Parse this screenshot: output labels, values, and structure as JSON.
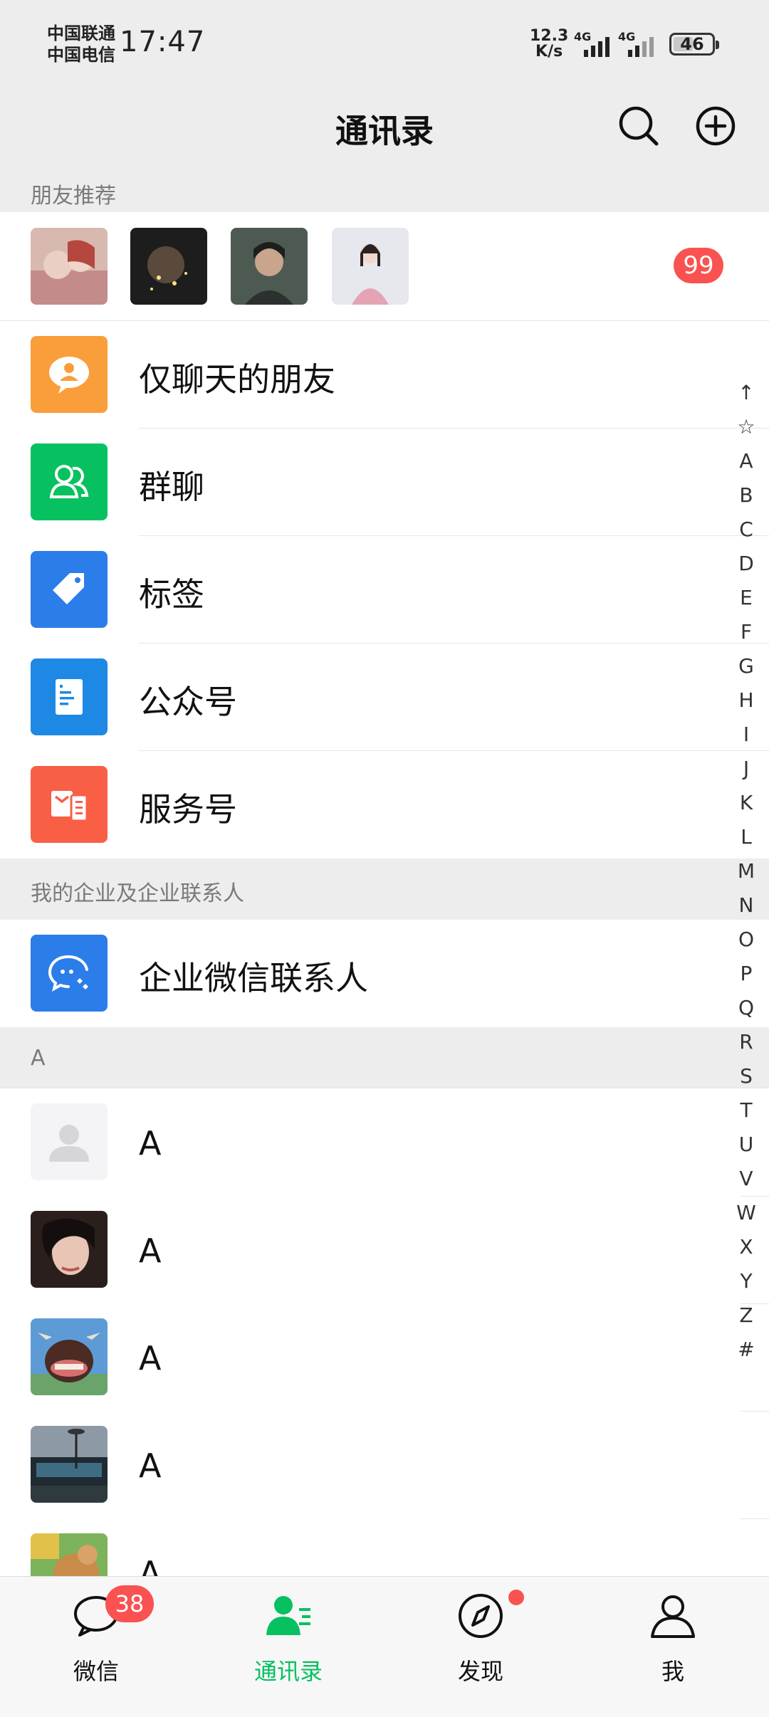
{
  "status_bar": {
    "carrier_1": "中国联通",
    "carrier_2": "中国电信",
    "time": "17:47",
    "net_speed_value": "12.3",
    "net_speed_unit": "K/s",
    "signal_1_label": "4G",
    "signal_2_label": "4G",
    "battery": "46"
  },
  "header": {
    "title": "通讯录",
    "search_icon": "search-icon",
    "add_icon": "add-circle-icon"
  },
  "recommend": {
    "section_label": "朋友推荐",
    "badge": "99"
  },
  "features": [
    {
      "label": "仅聊天的朋友",
      "icon": "chat-only-friends-icon",
      "color": "#fa9d3b"
    },
    {
      "label": "群聊",
      "icon": "group-chat-icon",
      "color": "#07c160"
    },
    {
      "label": "标签",
      "icon": "tag-icon",
      "color": "#2b7de9"
    },
    {
      "label": "公众号",
      "icon": "official-account-icon",
      "color": "#1e88e5"
    },
    {
      "label": "服务号",
      "icon": "service-account-icon",
      "color": "#f95f45"
    }
  ],
  "enterprise": {
    "section_label": "我的企业及企业联系人",
    "item_label": "企业微信联系人",
    "color": "#2b7de9"
  },
  "contacts": {
    "section_label": "A",
    "items": [
      {
        "name": "A"
      },
      {
        "name": "A"
      },
      {
        "name": "A"
      },
      {
        "name": "A"
      },
      {
        "name": "A"
      }
    ]
  },
  "alpha_index": [
    "↑",
    "☆",
    "A",
    "B",
    "C",
    "D",
    "E",
    "F",
    "G",
    "H",
    "I",
    "J",
    "K",
    "L",
    "M",
    "N",
    "O",
    "P",
    "Q",
    "R",
    "S",
    "T",
    "U",
    "V",
    "W",
    "X",
    "Y",
    "Z",
    "#"
  ],
  "bottom_nav": {
    "chats_label": "微信",
    "chats_badge": "38",
    "contacts_label": "通讯录",
    "discover_label": "发现",
    "me_label": "我",
    "active_color": "#07c160"
  }
}
